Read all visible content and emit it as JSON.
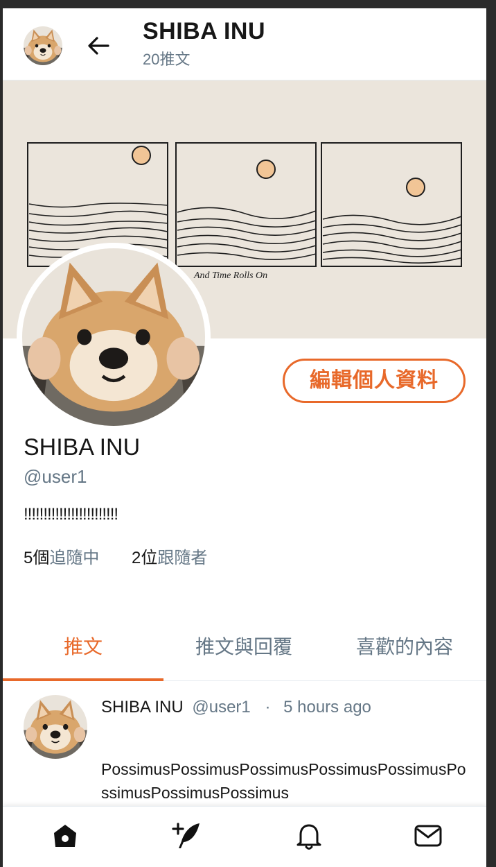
{
  "colors": {
    "accent": "#e8692a",
    "muted": "#657786",
    "text": "#171717",
    "divider": "#e6ecf0"
  },
  "header": {
    "title": "SHIBA INU",
    "tweet_count": "20推文",
    "back_icon": "arrow-left-icon"
  },
  "banner": {
    "caption": "And Time Rolls On"
  },
  "profile": {
    "edit_label": "編輯個人資料",
    "name": "SHIBA INU",
    "handle": "@user1",
    "bio": "!!!!!!!!!!!!!!!!!!!!!!!!",
    "following_count": "5個",
    "following_label": "追隨中",
    "followers_count": "2位",
    "followers_label": "跟隨者"
  },
  "tabs": [
    {
      "label": "推文",
      "active": true
    },
    {
      "label": "推文與回覆",
      "active": false
    },
    {
      "label": "喜歡的內容",
      "active": false
    }
  ],
  "tweet": {
    "name": "SHIBA INU",
    "handle": "@user1",
    "separator": "·",
    "time": "5 hours ago",
    "text": "PossimusPossimusPossimusPossimusPossimusPossimusPossimusPossimus"
  },
  "bottom_nav": [
    {
      "icon": "home-icon"
    },
    {
      "icon": "compose-tweet-icon"
    },
    {
      "icon": "bell-icon"
    },
    {
      "icon": "mail-icon"
    }
  ]
}
